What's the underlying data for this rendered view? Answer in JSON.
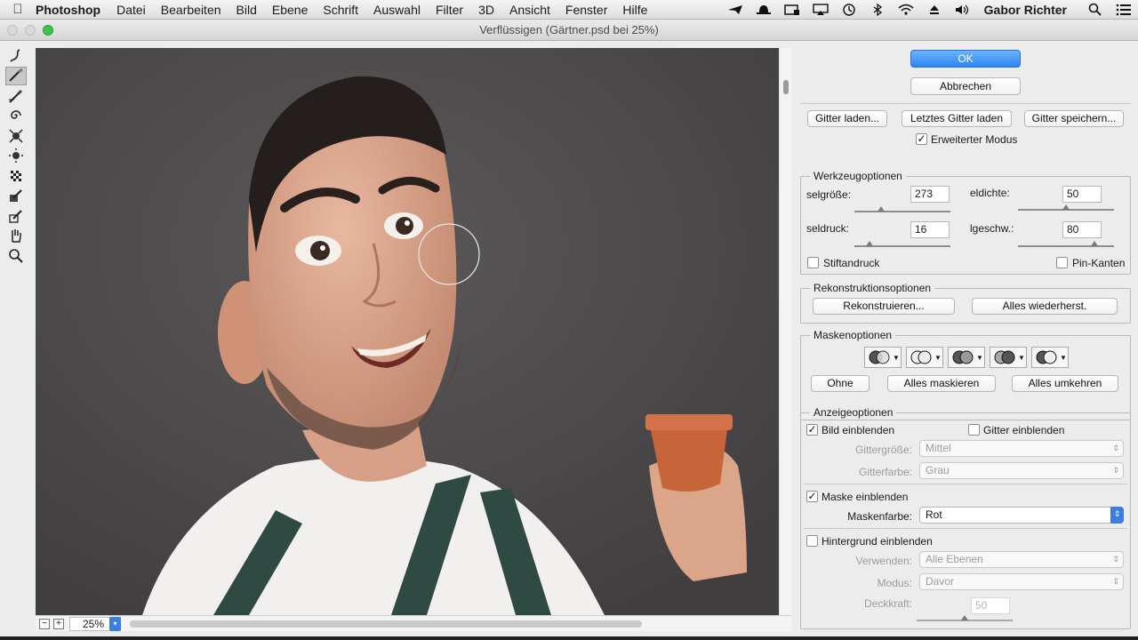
{
  "menubar": {
    "app_name": "Photoshop",
    "menus": [
      "Datei",
      "Bearbeiten",
      "Bild",
      "Ebene",
      "Schrift",
      "Auswahl",
      "Filter",
      "3D",
      "Ansicht",
      "Fenster",
      "Hilfe"
    ],
    "user": "Gabor Richter"
  },
  "window": {
    "title": "Verflüssigen (Gärtner.psd bei 25%)"
  },
  "status": {
    "zoom": "25%"
  },
  "panel": {
    "ok_label": "OK",
    "cancel_label": "Abbrechen",
    "load_mesh": "Gitter laden...",
    "load_last_mesh": "Letztes Gitter laden",
    "save_mesh": "Gitter speichern...",
    "advanced_mode": {
      "label": "Erweiterter Modus",
      "checked": true
    },
    "tool_options": {
      "title": "Werkzeugoptionen",
      "brush_size_label": "selgröße:",
      "brush_size": "273",
      "brush_size_level": 0.28,
      "brush_density_label": "eldichte:",
      "brush_density": "50",
      "brush_density_level": 0.5,
      "brush_pressure_label": "seldruck:",
      "brush_pressure": "16",
      "brush_pressure_level": 0.16,
      "brush_rate_label": "lgeschw.:",
      "brush_rate": "80",
      "brush_rate_level": 0.8,
      "stylus_pressure": "Stiftandruck",
      "pin_edges": "Pin-Kanten"
    },
    "reconstruct_options": {
      "title": "Rekonstruktionsoptionen",
      "reconstruct": "Rekonstruieren...",
      "restore_all": "Alles wiederherst."
    },
    "mask_options": {
      "title": "Maskenoptionen",
      "none": "Ohne",
      "mask_all": "Alles maskieren",
      "invert_all": "Alles umkehren"
    },
    "view_options": {
      "title": "Anzeigeoptionen",
      "show_image": "Bild einblenden",
      "show_mesh": "Gitter einblenden",
      "mesh_size_label": "Gittergröße:",
      "mesh_size": "Mittel",
      "mesh_color_label": "Gitterfarbe:",
      "mesh_color": "Grau",
      "show_mask": "Maske einblenden",
      "mask_color_label": "Maskenfarbe:",
      "mask_color": "Rot",
      "show_backdrop": "Hintergrund einblenden",
      "use_label": "Verwenden:",
      "use": "Alle Ebenen",
      "mode_label": "Modus:",
      "mode": "Davor",
      "opacity_label": "Deckkraft:",
      "opacity": "50",
      "opacity_level": 0.5
    }
  },
  "colors": {
    "accent": "#2b86f4",
    "canvas_bg": "#4d4b4c"
  }
}
